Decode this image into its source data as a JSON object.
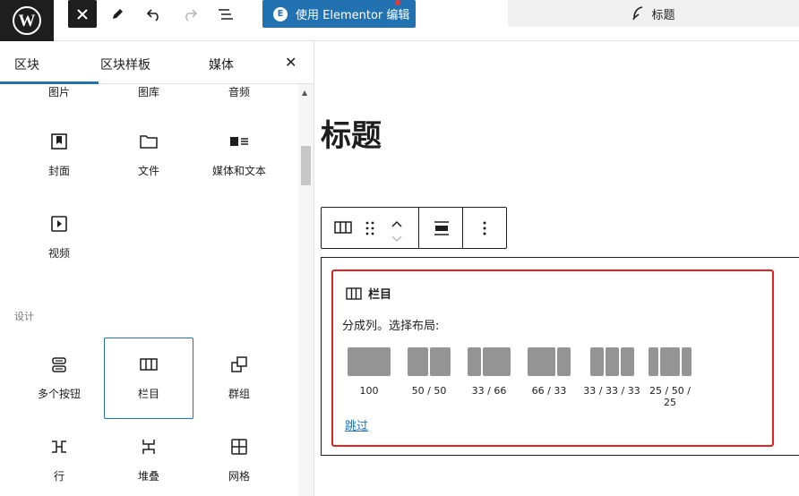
{
  "topbar": {
    "elementor_label": "使用 Elementor 编辑",
    "elementor_badge": "E",
    "doc_title": "标题"
  },
  "sidebar": {
    "tabs": [
      "区块",
      "区块样板",
      "媒体"
    ],
    "active_tab": "区块",
    "media_labels": [
      "图片",
      "图库",
      "音频"
    ],
    "media_blocks": [
      {
        "label": "封面",
        "icon": "cover-icon"
      },
      {
        "label": "文件",
        "icon": "file-icon"
      },
      {
        "label": "媒体和文本",
        "icon": "media-text-icon"
      },
      {
        "label": "视频",
        "icon": "video-icon"
      }
    ],
    "section_design": "设计",
    "design_blocks": [
      {
        "label": "多个按钮",
        "icon": "buttons-icon"
      },
      {
        "label": "栏目",
        "icon": "columns-icon",
        "selected": true
      },
      {
        "label": "群组",
        "icon": "group-icon"
      },
      {
        "label": "行",
        "icon": "row-icon"
      },
      {
        "label": "堆叠",
        "icon": "stack-icon"
      },
      {
        "label": "网格",
        "icon": "grid-icon"
      }
    ]
  },
  "editor": {
    "heading": "标题",
    "columns_block": {
      "title": "栏目",
      "description": "分成列。选择布局:",
      "variations": [
        {
          "label": "100",
          "split": [
            100
          ]
        },
        {
          "label": "50 / 50",
          "split": [
            50,
            50
          ]
        },
        {
          "label": "33 / 66",
          "split": [
            33,
            66
          ]
        },
        {
          "label": "66 / 33",
          "split": [
            66,
            33
          ]
        },
        {
          "label": "33 / 33 / 33",
          "split": [
            33,
            33,
            33
          ]
        },
        {
          "label": "25 / 50 / 25",
          "split": [
            25,
            50,
            25
          ]
        }
      ],
      "skip_label": "跳过"
    }
  },
  "colors": {
    "accent": "#2271b1",
    "highlight": "#e02424",
    "dark": "#1e1e1e"
  }
}
